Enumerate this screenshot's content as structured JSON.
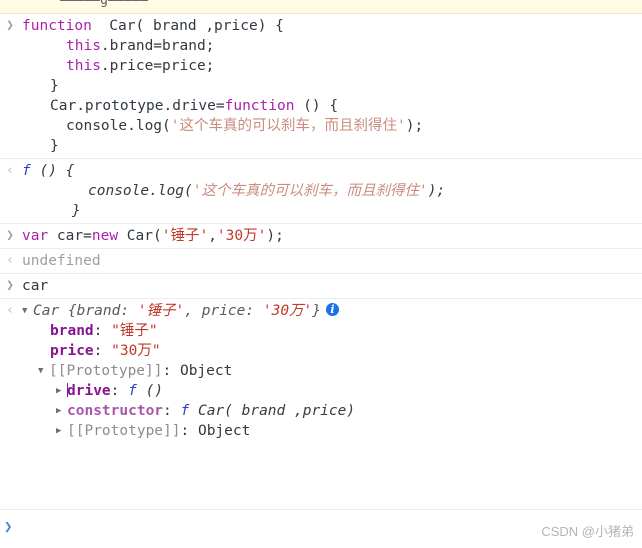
{
  "app": {
    "name": "chrome-devtools-console",
    "watermark": "CSDN @小猪弟"
  },
  "markers": {
    "input": "❯",
    "output": "‹",
    "prompt": "❯",
    "triangle_closed": "▶",
    "triangle_open": "▼",
    "info_badge": "i"
  },
  "clipped_top_row": {
    "text": "—————g—————"
  },
  "entries": [
    {
      "type": "input",
      "id": "entry-function-car",
      "lines": [
        {
          "kw": "function",
          "rest": "  Car( brand ,price) {"
        },
        {
          "indent": "    ",
          "kw2": "this",
          "rest": ".brand=brand;"
        },
        {
          "indent": "    ",
          "kw2": "this",
          "rest": ".price=price;"
        },
        {
          "indent": "  ",
          "rest": "}"
        },
        {
          "indent": "  ",
          "pre": "Car.prototype.drive=",
          "kw": "function",
          "rest": " () {"
        },
        {
          "indent": "    ",
          "pre": "console.log(",
          "str": "'这个车真的可以刹车，而且刹得住'",
          "rest": ");"
        },
        {
          "indent": "  ",
          "rest": "}"
        }
      ]
    },
    {
      "type": "output",
      "id": "entry-function-echo",
      "lines": [
        {
          "fn": "f",
          "rest": " () {"
        },
        {
          "indent": "    ",
          "pre": "console.log(",
          "str": "'这个车真的可以刹车，而且刹得住'",
          "rest": ");"
        },
        {
          "indent": "  ",
          "rest": "}"
        }
      ]
    },
    {
      "type": "input",
      "id": "entry-var-car",
      "text": "var car=new Car('锤子','30万');",
      "tokens": {
        "kw1": "var",
        "mid1": " car=",
        "kw2": "new",
        "mid2": " Car(",
        "str1": "'锤子'",
        "comma": ",",
        "str2": "'30万'",
        "tail": ");"
      }
    },
    {
      "type": "output",
      "id": "entry-undefined",
      "text": "undefined"
    },
    {
      "type": "input",
      "id": "entry-car",
      "text": "car"
    }
  ],
  "object_result": {
    "id": "entry-car-object",
    "preview": {
      "classname": "Car",
      "open": " {",
      "key1": "brand",
      "sep1": ": ",
      "val1": "'锤子'",
      "comma": ", ",
      "key2": "price",
      "sep2": ": ",
      "val2": "'30万'",
      "close": "}"
    },
    "properties": [
      {
        "name": "brand",
        "separator": ": ",
        "value": "\"锤子\""
      },
      {
        "name": "price",
        "separator": ": ",
        "value": "\"30万\""
      }
    ],
    "prototype": {
      "label": "[[Prototype]]",
      "separator": ": ",
      "value": "Object",
      "expanded": true,
      "children": [
        {
          "name": "drive",
          "separator": ": ",
          "fn": "f",
          "signature": " ()",
          "has_caret": true
        },
        {
          "name": "constructor",
          "separator": ": ",
          "fn": "f",
          "signature": " Car( brand ,price)",
          "has_caret": false
        },
        {
          "name": "[[Prototype]]",
          "separator": ": ",
          "value": "Object",
          "internal": true
        }
      ]
    }
  },
  "colors": {
    "keyword": "#aa22aa",
    "string": "#c0392b",
    "property": "#881391",
    "function": "#2a40d0",
    "grey": "#9aa0a6",
    "badge": "#1a73e8",
    "prompt": "#4a7fd4",
    "separator": "#ededed",
    "clipped_bg": "#fffbe5"
  }
}
